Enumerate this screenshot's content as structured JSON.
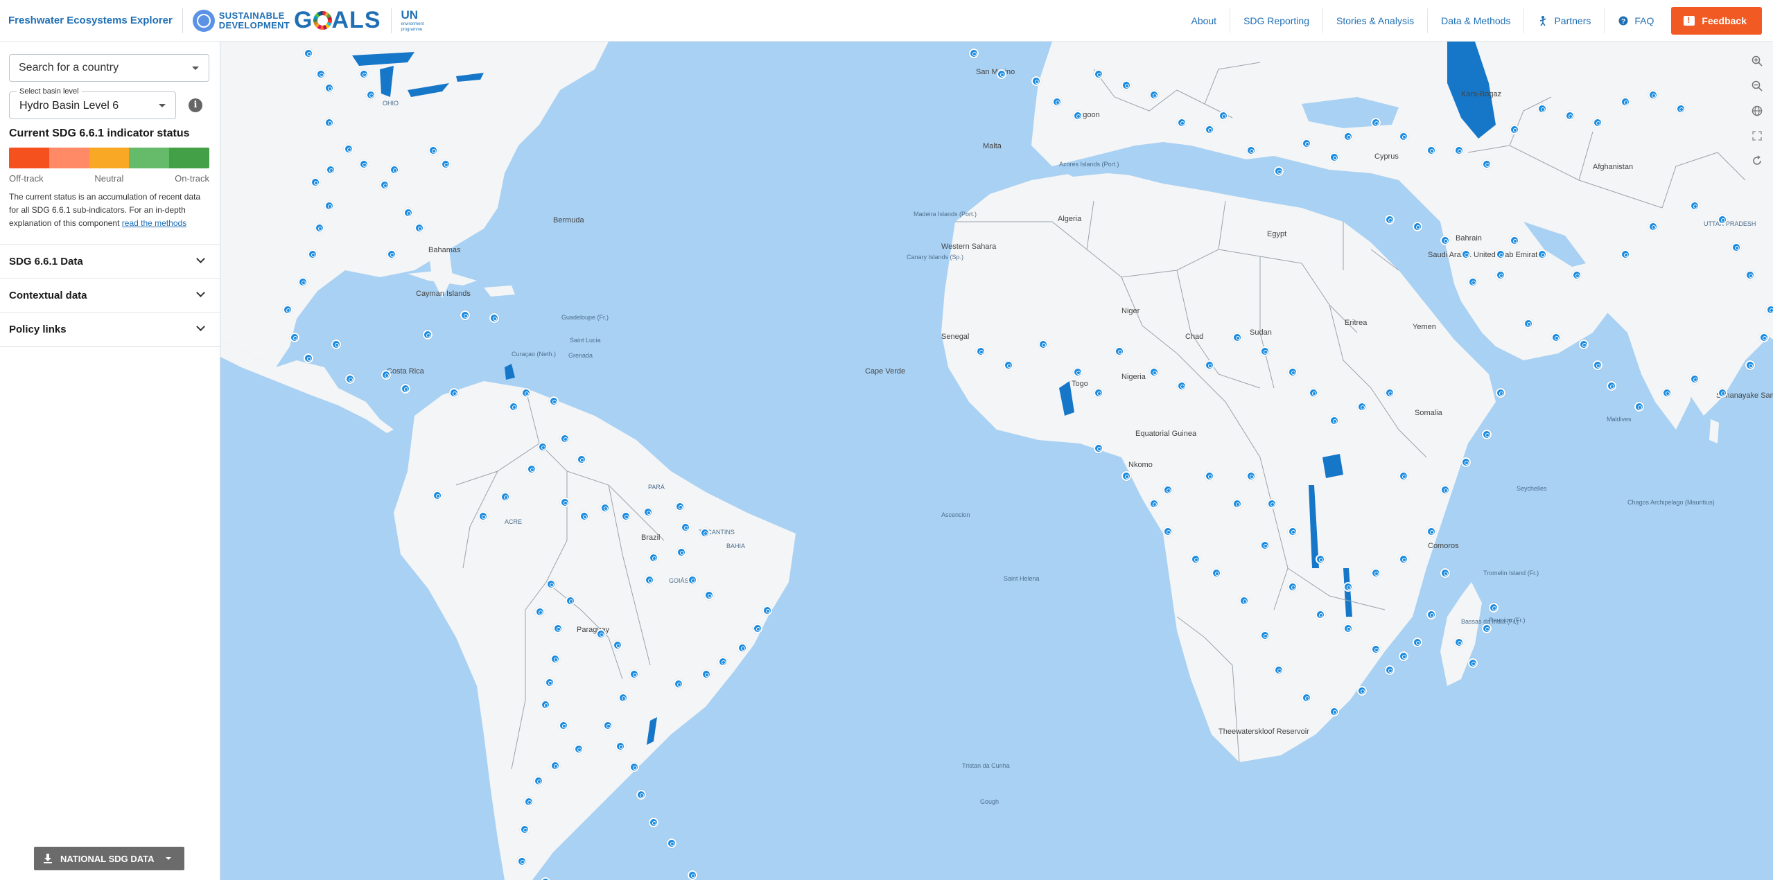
{
  "header": {
    "app_title": "Freshwater Ecosystems Explorer",
    "sdg_line1": "SUSTAINABLE",
    "sdg_line2": "DEVELOPMENT",
    "sdg_goals_g": "G",
    "sdg_goals_rest": "ALS",
    "unep_un": "UN",
    "unep_line1": "environment",
    "unep_line2": "programme",
    "nav": [
      "About",
      "SDG Reporting",
      "Stories & Analysis",
      "Data & Methods",
      "Partners",
      "FAQ"
    ],
    "feedback_label": "Feedback"
  },
  "sidebar": {
    "search_placeholder": "Search for a country",
    "basin_label": "Select basin level",
    "basin_value": "Hydro Basin Level 6",
    "info_icon": "i",
    "status_title": "Current SDG 6.6.1 indicator status",
    "status_colors": [
      "#f4511e",
      "#ff8a65",
      "#f9a825",
      "#66bb6a",
      "#43a047"
    ],
    "legend": {
      "left": "Off-track",
      "middle": "Neutral",
      "right": "On-track"
    },
    "description": "The current status is an accumulation of recent data for all SDG 6.6.1 sub-indicators. For an in-depth explanation of this component ",
    "description_link": "read the methods",
    "accordions": [
      "SDG 6.6.1 Data",
      "Contextual data",
      "Policy links"
    ],
    "national_button": "NATIONAL SDG DATA"
  },
  "map": {
    "ocean_color": "#a9d1f3",
    "land_color": "#f4f5f6",
    "water_color": "#1677c9",
    "labels": [
      {
        "text": "Bermuda",
        "kind": "country"
      },
      {
        "text": "Azores Islands (Port.)",
        "kind": "small"
      },
      {
        "text": "Madeira Islands (Port.)",
        "kind": "small"
      },
      {
        "text": "Canary Islands (Sp.)",
        "kind": "small"
      },
      {
        "text": "Cape Verde",
        "kind": "country"
      },
      {
        "text": "Algeria",
        "kind": "country"
      },
      {
        "text": "Western Sahara",
        "kind": "country"
      },
      {
        "text": "Egypt",
        "kind": "country"
      },
      {
        "text": "Niger",
        "kind": "country"
      },
      {
        "text": "Chad",
        "kind": "country"
      },
      {
        "text": "Sudan",
        "kind": "country"
      },
      {
        "text": "Nigeria",
        "kind": "country"
      },
      {
        "text": "Senegal",
        "kind": "country"
      },
      {
        "text": "Eritrea",
        "kind": "country"
      },
      {
        "text": "Yemen",
        "kind": "country"
      },
      {
        "text": "Saudi Arabia",
        "kind": "country"
      },
      {
        "text": "Bahrain",
        "kind": "country"
      },
      {
        "text": "United Arab Emirates",
        "kind": "country"
      },
      {
        "text": "Afghanistan",
        "kind": "country"
      },
      {
        "text": "Kara-Bogaz",
        "kind": "country"
      },
      {
        "text": "Somalia",
        "kind": "country"
      },
      {
        "text": "Maldives",
        "kind": "small"
      },
      {
        "text": "Seychelles",
        "kind": "small"
      },
      {
        "text": "Chagos Archipelago (Mauritius)",
        "kind": "small"
      },
      {
        "text": "Comoros",
        "kind": "country"
      },
      {
        "text": "Tromelin Island (Fr.)",
        "kind": "small"
      },
      {
        "text": "Reunion (Fr.)",
        "kind": "small"
      },
      {
        "text": "Bassas da India (Fr.)",
        "kind": "small"
      },
      {
        "text": "Equatorial Guinea",
        "kind": "country"
      },
      {
        "text": "Togo",
        "kind": "country"
      },
      {
        "text": "Ascencion",
        "kind": "small"
      },
      {
        "text": "Saint Helena",
        "kind": "small"
      },
      {
        "text": "Tristan da Cunha",
        "kind": "small"
      },
      {
        "text": "Gough",
        "kind": "small"
      },
      {
        "text": "Brazil",
        "kind": "country"
      },
      {
        "text": "Paraguay",
        "kind": "country"
      },
      {
        "text": "Bahamas",
        "kind": "country"
      },
      {
        "text": "Cayman Islands",
        "kind": "country"
      },
      {
        "text": "Costa Rica",
        "kind": "country"
      },
      {
        "text": "Guadeloupe (Fr.)",
        "kind": "small"
      },
      {
        "text": "Saint Lucia",
        "kind": "small"
      },
      {
        "text": "Grenada",
        "kind": "small"
      },
      {
        "text": "Curaçao (Neth.)",
        "kind": "small"
      },
      {
        "text": "Cyprus",
        "kind": "country"
      },
      {
        "text": "Malta",
        "kind": "country"
      },
      {
        "text": "San Marino",
        "kind": "country"
      },
      {
        "text": "Senanayake Samudra",
        "kind": "country"
      },
      {
        "text": "Theewaterskloof Reservoir",
        "kind": "country"
      },
      {
        "text": "Lagoon",
        "kind": "country"
      },
      {
        "text": "Nkomo",
        "kind": "country"
      },
      {
        "text": "TOCANTINS",
        "kind": "small"
      },
      {
        "text": "BAHIA",
        "kind": "small"
      },
      {
        "text": "GOIÁS",
        "kind": "small"
      },
      {
        "text": "PARÁ",
        "kind": "small"
      },
      {
        "text": "ACRE",
        "kind": "small"
      },
      {
        "text": "OHIO",
        "kind": "small"
      },
      {
        "text": "UTTAR PRADESH",
        "kind": "small"
      }
    ]
  }
}
